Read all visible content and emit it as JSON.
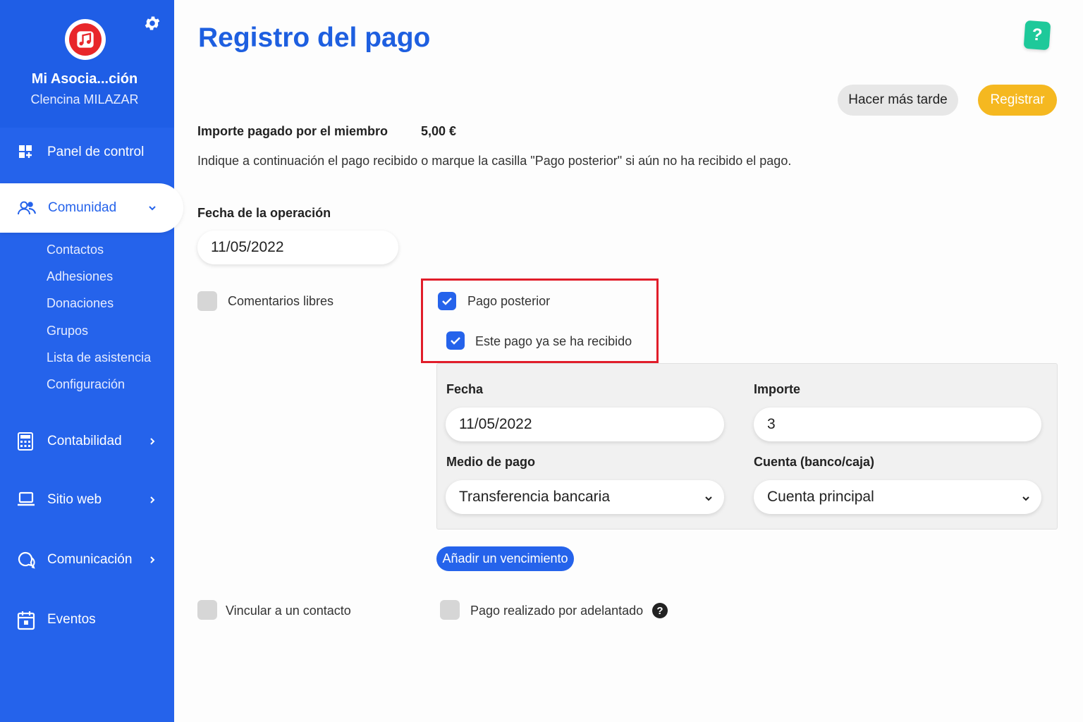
{
  "sidebar": {
    "org_name": "Mi Asocia...ción",
    "user_name": "Clencina MILAZAR",
    "nav": {
      "dashboard": "Panel de control",
      "community": "Comunidad",
      "accounting": "Contabilidad",
      "website": "Sitio web",
      "communication": "Comunicación",
      "events": "Eventos"
    },
    "community_sub": [
      "Contactos",
      "Adhesiones",
      "Donaciones",
      "Grupos",
      "Lista de asistencia",
      "Configuración"
    ]
  },
  "header": {
    "title": "Registro del pago",
    "help_label": "?",
    "later_button": "Hacer más tarde",
    "register_button": "Registrar"
  },
  "payment": {
    "amount_label": "Importe pagado por el miembro",
    "amount_value": "5,00 €",
    "instructions": "Indique a continuación el pago recibido o marque la casilla \"Pago posterior\" si aún no ha recibido el pago.",
    "operation_date_label": "Fecha de la operación",
    "operation_date_value": "11/05/2022",
    "free_comments_label": "Comentarios libres",
    "deferred_label": "Pago posterior",
    "received_label": "Este pago ya se ha recibido",
    "date_label": "Fecha",
    "date_value": "11/05/2022",
    "amount_field_label": "Importe",
    "amount_field_value": "3",
    "method_label": "Medio de pago",
    "method_value": "Transferencia bancaria",
    "account_label": "Cuenta (banco/caja)",
    "account_value": "Cuenta principal",
    "add_due_button": "Añadir un vencimiento",
    "link_contact_label": "Vincular a un contacto",
    "advance_label": "Pago realizado por adelantado",
    "advance_help": "?"
  },
  "state": {
    "free_comments_checked": false,
    "deferred_checked": true,
    "received_checked": true,
    "link_contact_checked": false,
    "advance_checked": false
  },
  "colors": {
    "sidebar": "#2563eb",
    "accent": "#1e5fe0",
    "register": "#f5b820",
    "help": "#1ec99a",
    "highlight": "#e11d2a"
  }
}
